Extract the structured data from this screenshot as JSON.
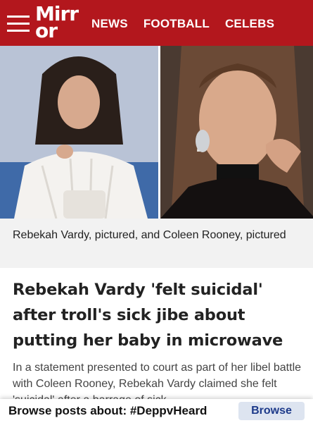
{
  "header": {
    "logo_line1": "Mirr",
    "logo_line2": "or",
    "nav": [
      "NEWS",
      "FOOTBALL",
      "CELEBS"
    ]
  },
  "article": {
    "caption": "Rebekah Vardy, pictured, and Coleen Rooney, pictured",
    "headline": "Rebekah Vardy 'felt suicidal' after troll's sick jibe about putting her baby in microwave",
    "standfirst": "In a statement presented to court as part of her libel battle with Coleen Rooney, Rebekah Vardy claimed she felt 'suicidal' after a barrage of sick"
  },
  "banner": {
    "text": "Browse posts about: #DeppvHeard",
    "button": "Browse"
  },
  "colors": {
    "brand": "#b3171d",
    "caption_bg": "#f2f2f2",
    "button_bg": "#dde4f0"
  }
}
